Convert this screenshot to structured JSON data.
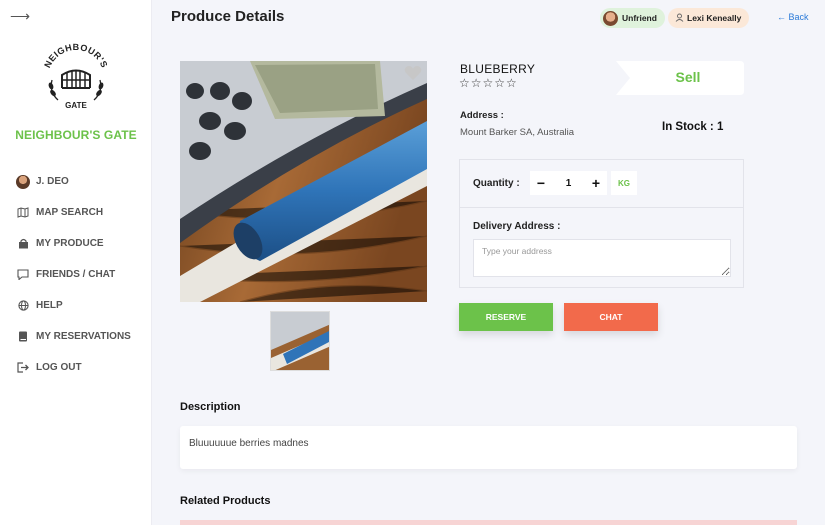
{
  "sidebar": {
    "brand": "NEIGHBOUR'S GATE",
    "logo_text_top": "NEIGHBOUR'S",
    "logo_text_bottom": "GATE",
    "items": [
      {
        "label": "J. DEO",
        "icon": "user-avatar"
      },
      {
        "label": "MAP SEARCH",
        "icon": "map-icon"
      },
      {
        "label": "MY PRODUCE",
        "icon": "bag-icon"
      },
      {
        "label": "FRIENDS / CHAT",
        "icon": "chat-icon"
      },
      {
        "label": "HELP",
        "icon": "globe-icon"
      },
      {
        "label": "MY RESERVATIONS",
        "icon": "book-icon"
      },
      {
        "label": "LOG OUT",
        "icon": "logout-icon"
      }
    ]
  },
  "header": {
    "title": "Produce Details",
    "unfriend_label": "Unfriend",
    "user_label": "Lexi Keneally",
    "back_label": "← Back"
  },
  "product": {
    "name": "BLUEBERRY",
    "stars": "☆☆☆☆☆",
    "rating": 0,
    "type_label": "Sell",
    "address_label": "Address :",
    "address_value": "Mount Barker SA, Australia",
    "stock_label": "In Stock : 1"
  },
  "order": {
    "quantity_label": "Quantity :",
    "minus": "−",
    "plus": "+",
    "quantity_value": "1",
    "unit": "KG",
    "delivery_label": "Delivery Address :",
    "delivery_placeholder": "Type your address"
  },
  "actions": {
    "reserve_label": "RESERVE",
    "chat_label": "CHAT"
  },
  "description": {
    "title": "Description",
    "text": "Bluuuuuue berries madnes"
  },
  "related": {
    "title": "Related Products"
  },
  "colors": {
    "accent_green": "#6cc24a",
    "chat_orange": "#f26a4b",
    "link_blue": "#2a7ad8"
  }
}
